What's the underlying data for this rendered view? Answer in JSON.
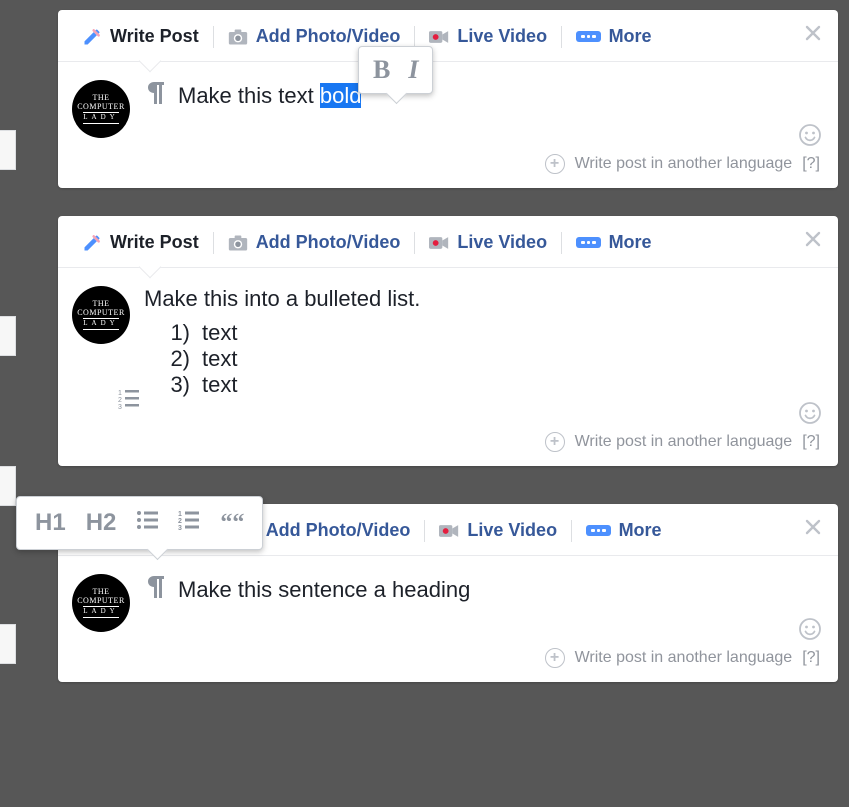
{
  "tabs": {
    "write": "Write Post",
    "photo": "Add Photo/Video",
    "live": "Live Video",
    "more": "More"
  },
  "avatar": {
    "line1": "THE",
    "line2": "COMPUTER",
    "line3": "LADY"
  },
  "footer": {
    "another_lang": "Write post in another language",
    "help": "[?]"
  },
  "panel1": {
    "text_before": "Make this text ",
    "text_highlight": "bold",
    "toolbar": {
      "bold": "B",
      "italic": "I"
    }
  },
  "panel2": {
    "heading": "Make this into a bulleted list.",
    "items": [
      {
        "num": "1)",
        "text": "text"
      },
      {
        "num": "2)",
        "text": "text"
      },
      {
        "num": "3)",
        "text": "text"
      }
    ]
  },
  "panel3": {
    "text": "Make this sentence a heading",
    "toolbar": {
      "h1": "H1",
      "h2": "H2",
      "quote": "““"
    }
  }
}
